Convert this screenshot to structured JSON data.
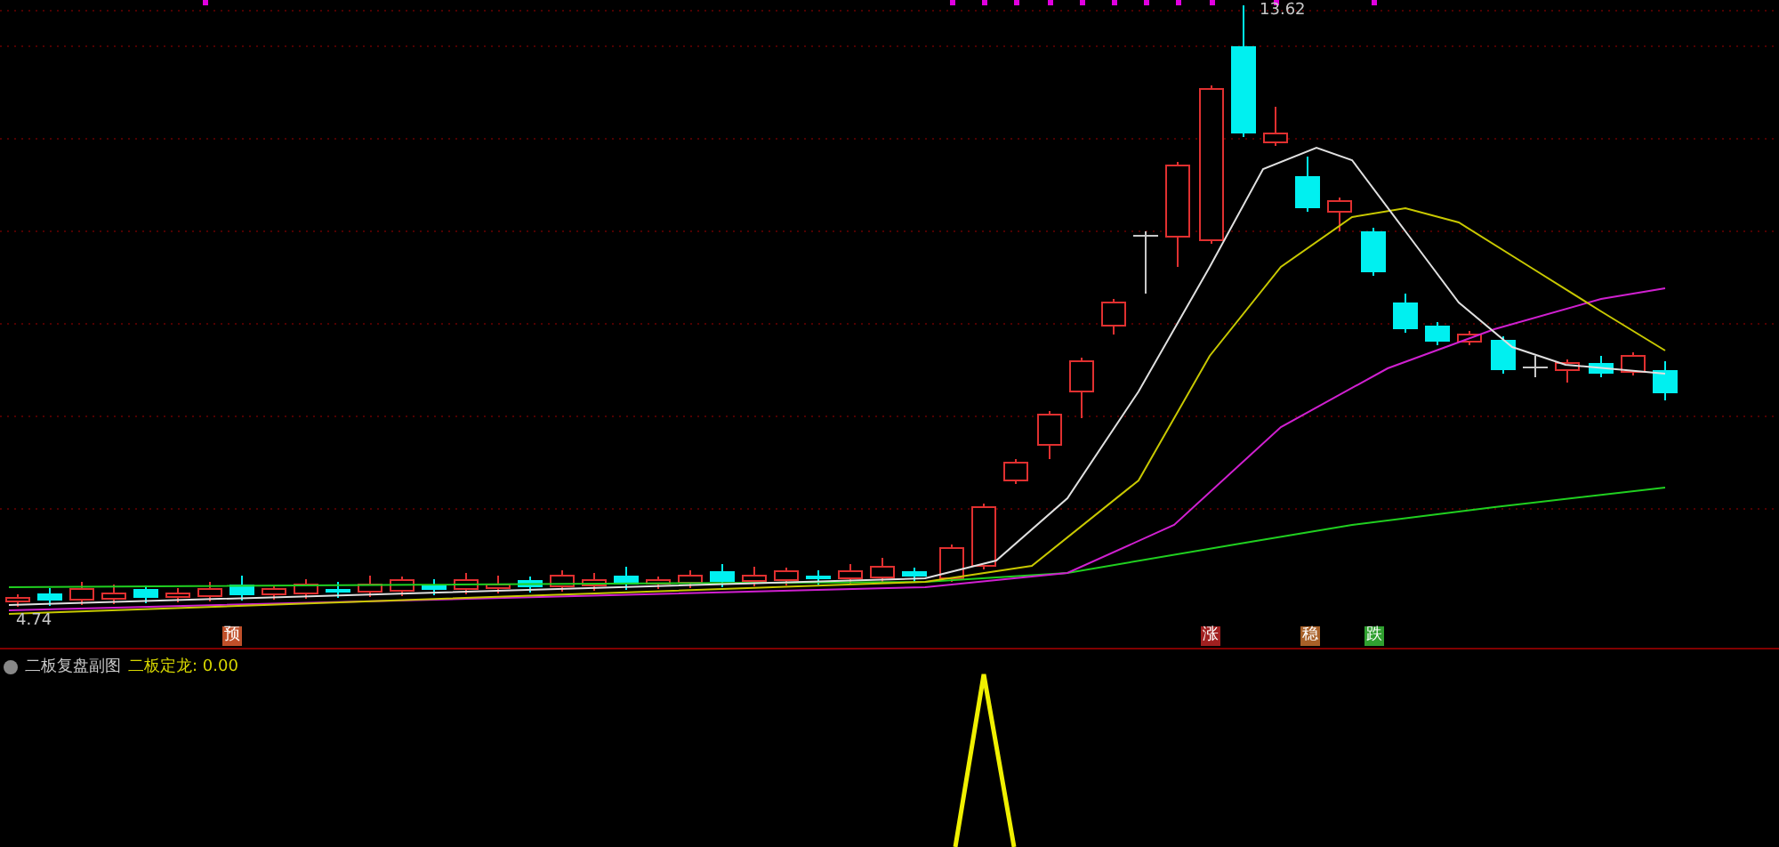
{
  "price_chart": {
    "high_label": "13.62",
    "low_label": "4.74",
    "signal_markers": [
      {
        "text": "预",
        "color": "#c0502a"
      },
      {
        "text": "涨",
        "color": "#a02020"
      },
      {
        "text": "稳",
        "color": "#a86028"
      },
      {
        "text": "跌",
        "color": "#30a030"
      }
    ]
  },
  "indicator_panel": {
    "title": "二板复盘副图",
    "readings": [
      {
        "text": "二板定龙: 0.00"
      }
    ]
  }
}
